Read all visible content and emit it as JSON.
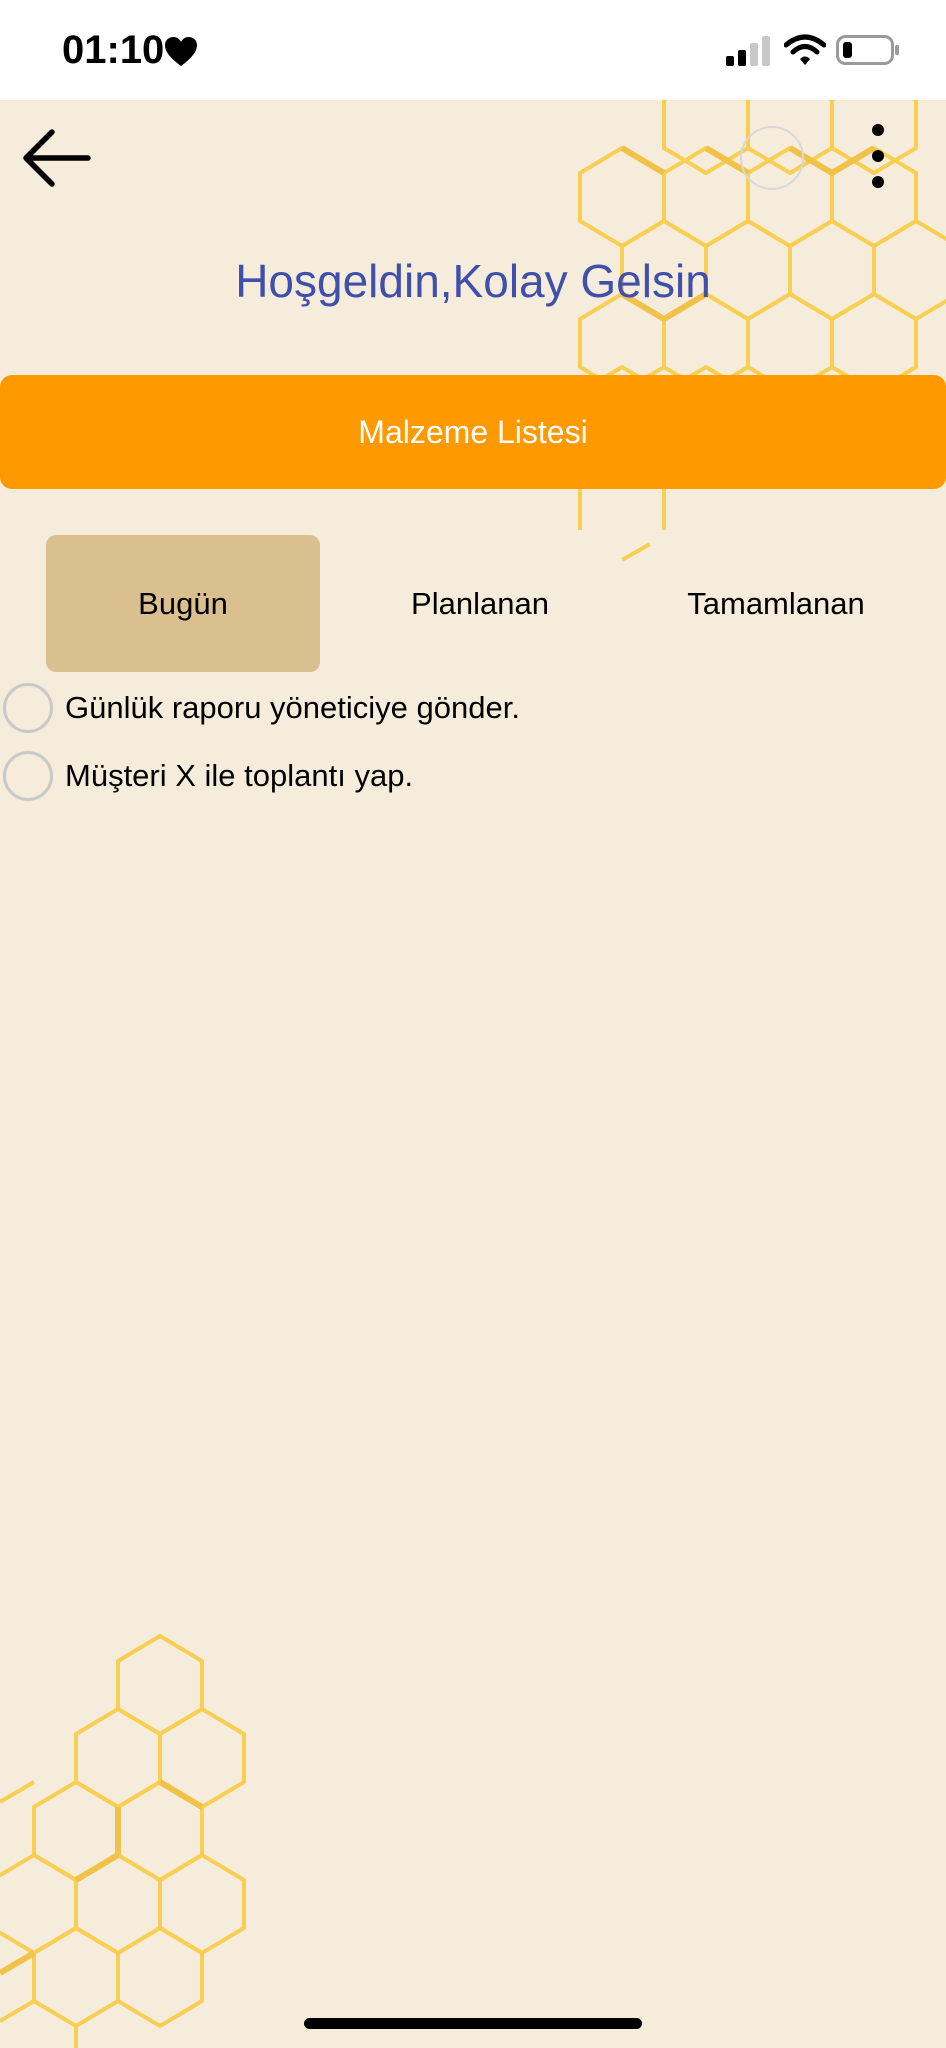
{
  "status_bar": {
    "time": "01:10",
    "icons": [
      "heart-icon",
      "signal-icon",
      "wifi-icon",
      "battery-icon"
    ]
  },
  "header": {
    "back_icon": "arrow-left-icon",
    "more_icon": "more-vertical-icon",
    "title": "Hoşgeldin,Kolay Gelsin"
  },
  "banner": {
    "label": "Malzeme Listesi"
  },
  "tabs": [
    {
      "label": "Bugün",
      "active": true
    },
    {
      "label": "Planlanan",
      "active": false
    },
    {
      "label": "Tamamlanan",
      "active": false
    }
  ],
  "tasks": [
    {
      "label": "Günlük raporu yöneticiye gönder.",
      "checked": false
    },
    {
      "label": "Müşteri X ile toplantı yap.",
      "checked": false
    }
  ],
  "colors": {
    "background": "#f6ecdb",
    "accent": "#ff9900",
    "title": "#3f4fac",
    "active_tab": "#dbc08f",
    "honeycomb": "#f8cf52"
  }
}
